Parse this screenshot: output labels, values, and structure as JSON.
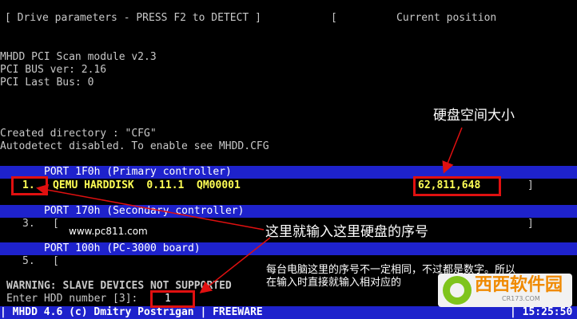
{
  "header": {
    "left": "[ Drive parameters - PRESS F2 to DETECT ]",
    "right_bracket": "[",
    "right": "Current position"
  },
  "console": {
    "line1": "MHDD PCI Scan module v2.3",
    "line2": "PCI BUS ver: 2.16",
    "line3": "PCI Last Bus: 0",
    "line4": "Created directory : \"CFG\"",
    "line5": "Autodetect disabled. To enable see MHDD.CFG"
  },
  "ports": [
    {
      "header": "PORT 1F0h (Primary controller)",
      "num": "1.",
      "model": "QEMU HARDDISK  0.11.1  QM00001",
      "size": "62,811,648",
      "close": "]"
    },
    {
      "header": "PORT 170h (Secondary controller)",
      "num": "3.",
      "bracket": "[",
      "close": "]"
    },
    {
      "header": "PORT 100h (PC-3000 board)",
      "num": "5.",
      "bracket": "["
    }
  ],
  "warning": "WARNING: SLAVE DEVICES NOT SUPPORTED",
  "prompt": {
    "label": "Enter HDD number [3]:",
    "value": "1"
  },
  "status_bar": {
    "left": "| MHDD 4.6 (c) Dmitry Postrigan | FREEWARE",
    "time": "| 15:25:50"
  },
  "annotations": {
    "disk_size": "硬盘空间大小",
    "enter_number": "这里就输入这里硬盘的序号",
    "note_line1": "每台电脑这里的序号不一定相同，不过都是数字。所以",
    "note_line2": "在输入时直接就输入相对应的",
    "site": "www.pc811.com"
  },
  "watermark": {
    "name": "西西软件园",
    "sub": "CR173.COM"
  },
  "colors": {
    "bar": "#1e22cc",
    "highlight_text": "#ffff55",
    "annotation_box": "#e01010"
  }
}
